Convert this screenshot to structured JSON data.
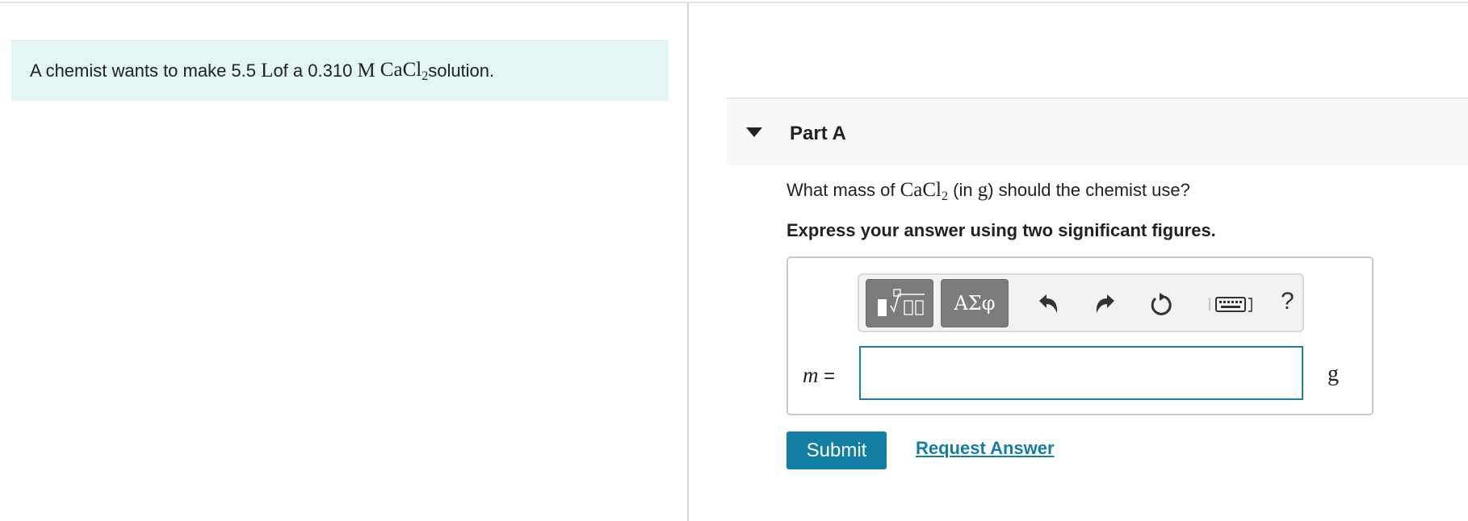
{
  "problem": {
    "prefix": "A chemist wants to make 5.5 ",
    "volume_unit": "L",
    "middle": " of a 0.310 ",
    "molarity_unit": "M",
    "compound_base": "CaCl",
    "compound_sub": "2",
    "suffix": " solution."
  },
  "part": {
    "title": "Part A",
    "question_prefix": "What mass of ",
    "question_compound_base": "CaCl",
    "question_compound_sub": "2",
    "question_middle": " (in ",
    "question_unit": "g",
    "question_suffix": ") should the chemist use?",
    "instruction": "Express your answer using two significant figures."
  },
  "toolbar": {
    "templates_icon": "templates-icon",
    "symbols_label": "ΑΣφ",
    "undo_icon": "undo-icon",
    "redo_icon": "redo-icon",
    "reset_icon": "reset-icon",
    "keyboard_icon": "keyboard-icon",
    "help_label": "?"
  },
  "answer": {
    "variable": "m",
    "equals": " =",
    "value": "",
    "unit": "g"
  },
  "actions": {
    "submit_label": "Submit",
    "request_label": "Request Answer"
  },
  "colors": {
    "accent": "#137ea4",
    "intro_bg": "#e4f5f6",
    "toolbar_btn": "#7b7b7b"
  }
}
